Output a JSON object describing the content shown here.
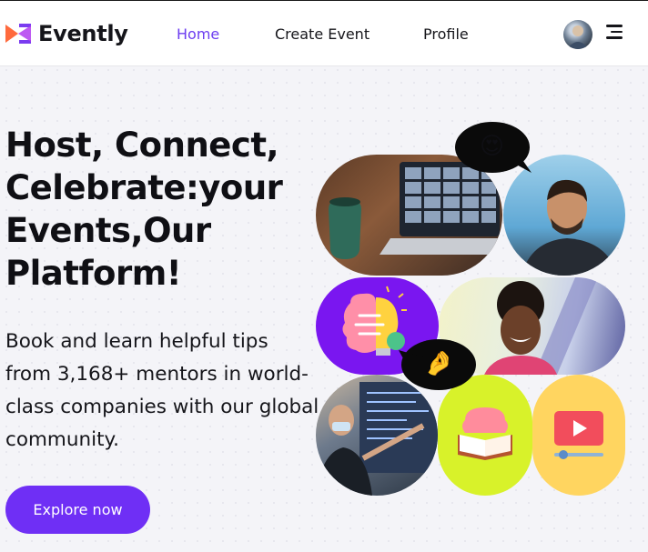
{
  "app": {
    "brand": "Evently",
    "colors": {
      "accent": "#6f2ff5",
      "nav_active": "#6c3df0",
      "logo_orange": "#ff6a3d",
      "logo_purple": "#7a3cf0"
    }
  },
  "nav": {
    "home": "Home",
    "create_event": "Create Event",
    "profile": "Profile"
  },
  "hero": {
    "title": "Host, Connect, Celebrate:your Events,Our Platform!",
    "subtitle": "Book and learn helpful tips from 3,168+ mentors in world-class companies with our global community.",
    "cta": "Explore now"
  },
  "collage": {
    "emoji_love": "😍",
    "emoji_hand": "🤌",
    "icons": [
      "video-call-photo",
      "smiling-man-photo",
      "brain-idea-icon",
      "smiling-woman-photo",
      "speaker-photo",
      "brain-book-icon",
      "video-play-icon"
    ]
  }
}
